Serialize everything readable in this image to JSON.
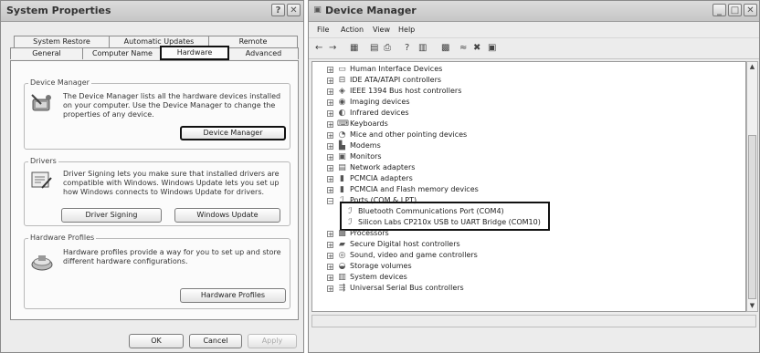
{
  "system_properties": {
    "title": "System Properties",
    "title_buttons": {
      "help": "?",
      "close": "✕"
    },
    "tabs_row1": [
      "System Restore",
      "Automatic Updates",
      "Remote"
    ],
    "tabs_row2": [
      "General",
      "Computer Name",
      "Hardware",
      "Advanced"
    ],
    "active_tab": "Hardware",
    "device_manager": {
      "label": "Device Manager",
      "text": "The Device Manager lists all the hardware devices installed on your computer. Use the Device Manager to change the properties of any device.",
      "button": "Device Manager"
    },
    "drivers": {
      "label": "Drivers",
      "text": "Driver Signing lets you make sure that installed drivers are compatible with Windows. Windows Update lets you set up how Windows connects to Windows Update for drivers.",
      "signing_button": "Driver Signing",
      "update_button": "Windows Update"
    },
    "hardware_profiles": {
      "label": "Hardware Profiles",
      "text": "Hardware profiles provide a way for you to set up and store different hardware configurations.",
      "button": "Hardware Profiles"
    },
    "footer": {
      "ok": "OK",
      "cancel": "Cancel",
      "apply": "Apply"
    }
  },
  "device_manager_window": {
    "title": "Device Manager",
    "title_buttons": {
      "minimize": "_",
      "maximize": "□",
      "close": "✕"
    },
    "menu": [
      "File",
      "Action",
      "View",
      "Help"
    ],
    "tree": [
      {
        "label": "Human Interface Devices",
        "expander": "+",
        "icon": "hid-icon"
      },
      {
        "label": "IDE ATA/ATAPI controllers",
        "expander": "+",
        "icon": "ide-icon"
      },
      {
        "label": "IEEE 1394 Bus host controllers",
        "expander": "+",
        "icon": "firewire-icon"
      },
      {
        "label": "Imaging devices",
        "expander": "+",
        "icon": "camera-icon"
      },
      {
        "label": "Infrared devices",
        "expander": "+",
        "icon": "infrared-icon"
      },
      {
        "label": "Keyboards",
        "expander": "+",
        "icon": "keyboard-icon"
      },
      {
        "label": "Mice and other pointing devices",
        "expander": "+",
        "icon": "mouse-icon"
      },
      {
        "label": "Modems",
        "expander": "+",
        "icon": "modem-icon"
      },
      {
        "label": "Monitors",
        "expander": "+",
        "icon": "monitor-icon"
      },
      {
        "label": "Network adapters",
        "expander": "+",
        "icon": "network-icon"
      },
      {
        "label": "PCMCIA adapters",
        "expander": "+",
        "icon": "pcmcia-icon"
      },
      {
        "label": "PCMCIA and Flash memory devices",
        "expander": "+",
        "icon": "flash-icon"
      },
      {
        "label": "Ports (COM & LPT)",
        "expander": "−",
        "icon": "port-icon"
      },
      {
        "label": "Bluetooth Communications Port (COM4)",
        "expander": "",
        "icon": "port-icon"
      },
      {
        "label": "Silicon Labs CP210x USB to UART Bridge (COM10)",
        "expander": "",
        "icon": "port-icon"
      },
      {
        "label": "Processors",
        "expander": "+",
        "icon": "cpu-icon"
      },
      {
        "label": "Secure Digital host controllers",
        "expander": "+",
        "icon": "sd-icon"
      },
      {
        "label": "Sound, video and game controllers",
        "expander": "+",
        "icon": "sound-icon"
      },
      {
        "label": "Storage volumes",
        "expander": "+",
        "icon": "storage-icon"
      },
      {
        "label": "System devices",
        "expander": "+",
        "icon": "system-icon"
      },
      {
        "label": "Universal Serial Bus controllers",
        "expander": "+",
        "icon": "usb-icon"
      }
    ]
  }
}
